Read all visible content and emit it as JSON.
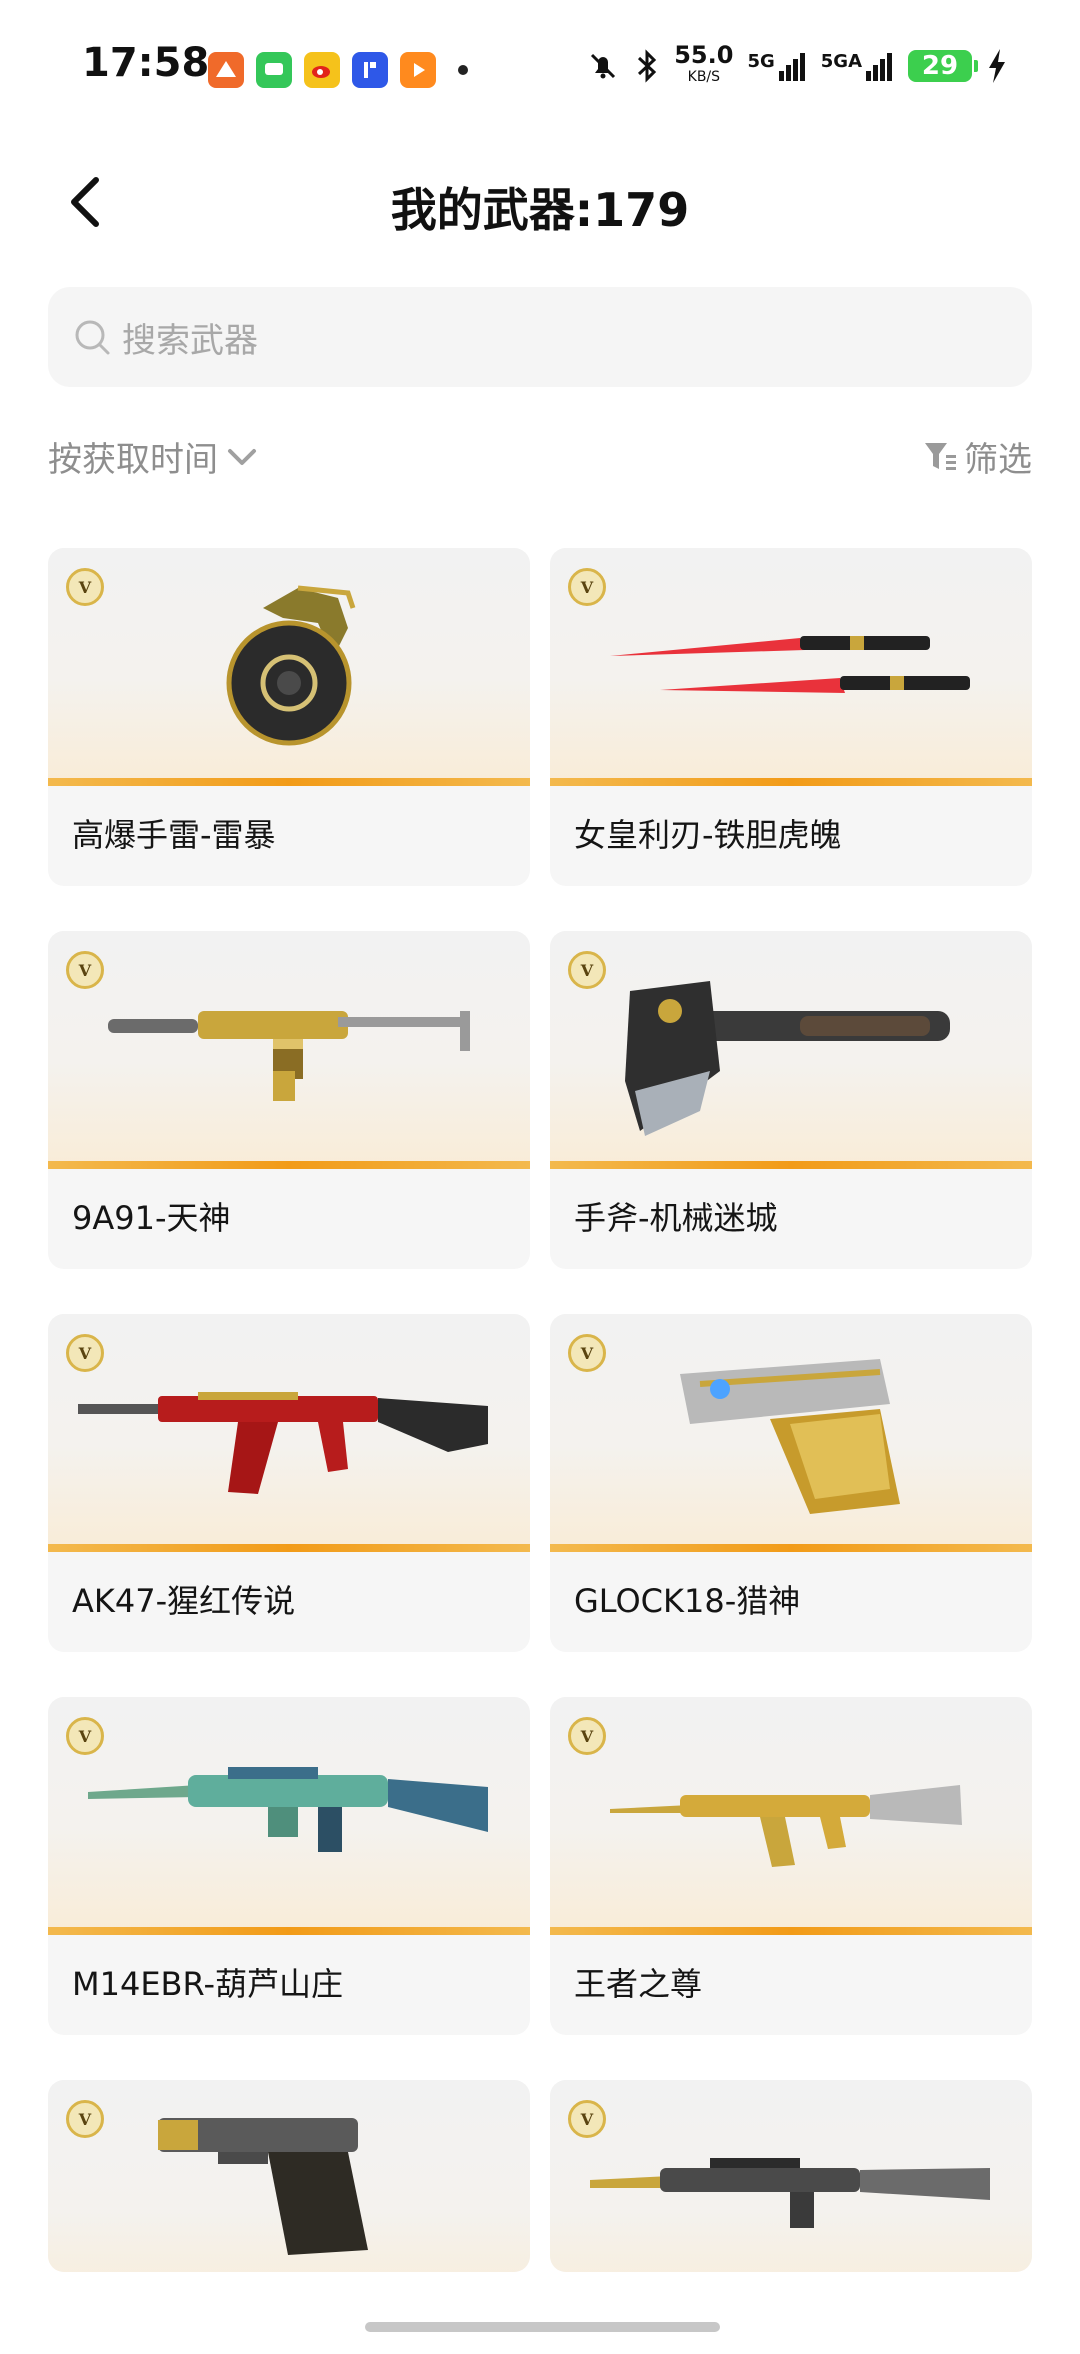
{
  "status_bar": {
    "time": "17:58",
    "app_icons": [
      "app-a-icon",
      "messages-icon",
      "weibo-icon",
      "pin-icon",
      "video-icon"
    ],
    "speed_value": "55.0",
    "speed_unit": "KB/S",
    "network_1": "5G",
    "network_2": "5GA",
    "battery": "29"
  },
  "header": {
    "title": "我的武器:179"
  },
  "search": {
    "placeholder": "搜索武器"
  },
  "sort": {
    "label": "按获取时间"
  },
  "filter": {
    "label": "筛选"
  },
  "weapons": [
    {
      "name": "高爆手雷-雷暴",
      "badge": "V"
    },
    {
      "name": "女皇利刃-铁胆虎魄",
      "badge": "V"
    },
    {
      "name": "9A91-天神",
      "badge": "V"
    },
    {
      "name": "手斧-机械迷城",
      "badge": "V"
    },
    {
      "name": "AK47-猩红传说",
      "badge": "V"
    },
    {
      "name": "GLOCK18-猎神",
      "badge": "V"
    },
    {
      "name": "M14EBR-葫芦山庄",
      "badge": "V"
    },
    {
      "name": "王者之尊",
      "badge": "V"
    },
    {
      "name": "",
      "badge": "V"
    },
    {
      "name": "",
      "badge": "V"
    }
  ],
  "colors": {
    "accent_bar": "#f29b18",
    "card_bg": "#f6f6f6",
    "muted_text": "#8e8e8e"
  }
}
